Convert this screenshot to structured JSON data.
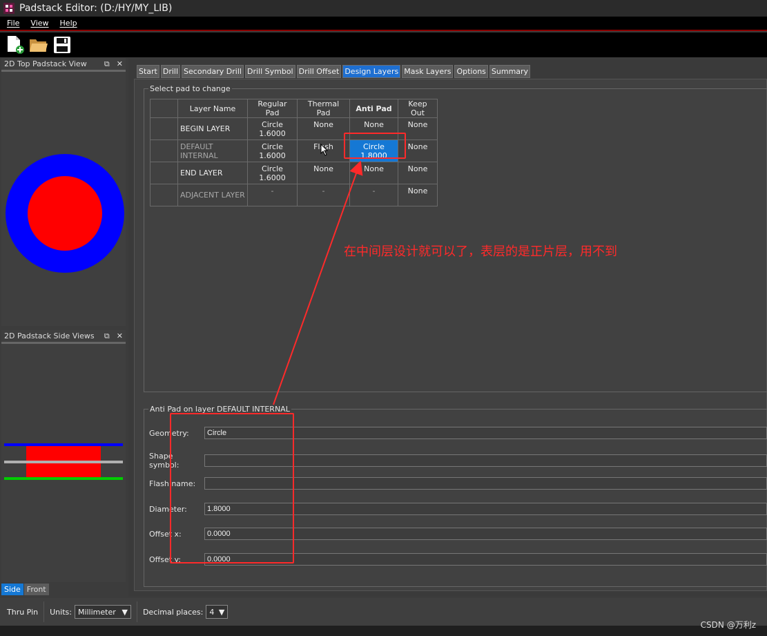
{
  "window": {
    "title": "Padstack Editor:  (D:/HY/MY_LIB)"
  },
  "menu": {
    "file": "File",
    "view": "View",
    "help": "Help"
  },
  "toolbar": {
    "new": "new-icon",
    "open": "folder-open-icon",
    "save": "save-icon"
  },
  "top_view": {
    "title": "2D Top Padstack View",
    "outer_color": "#0000ff",
    "inner_color": "#ff0000"
  },
  "side_view": {
    "title": "2D Padstack Side Views",
    "tabs": [
      "Side",
      "Front"
    ]
  },
  "tabs": [
    "Start",
    "Drill",
    "Secondary Drill",
    "Drill Symbol",
    "Drill Offset",
    "Design Layers",
    "Mask Layers",
    "Options",
    "Summary"
  ],
  "active_tab": "Design Layers",
  "select_group": {
    "title": "Select pad to change"
  },
  "grid": {
    "headers": [
      "Layer Name",
      "Regular Pad",
      "Thermal Pad",
      "Anti Pad",
      "Keep Out"
    ],
    "rows": [
      {
        "layer": "BEGIN LAYER",
        "regular": "Circle 1.6000",
        "thermal": "None",
        "anti": "None",
        "keepout": "None"
      },
      {
        "layer": "DEFAULT INTERNAL",
        "regular": "Circle 1.6000",
        "thermal": "Flash",
        "anti": "Circle 1.8000",
        "keepout": "None"
      },
      {
        "layer": "END LAYER",
        "regular": "Circle 1.6000",
        "thermal": "None",
        "anti": "None",
        "keepout": "None"
      },
      {
        "layer": "ADJACENT LAYER",
        "regular": "-",
        "thermal": "-",
        "anti": "-",
        "keepout": "None"
      }
    ]
  },
  "annotation": {
    "text": "在中间层设计就可以了，表层的是正片层，用不到"
  },
  "detail": {
    "title": "Anti Pad on layer DEFAULT INTERNAL",
    "geometry_label": "Geometry:",
    "geometry": "Circle",
    "shape_label": "Shape symbol:",
    "shape": "",
    "flash_label": "Flash name:",
    "flash": "",
    "diameter_label": "Diameter:",
    "diameter": "1.8000",
    "offsetx_label": "Offset x:",
    "offsetx": "0.0000",
    "offsety_label": "Offset y:",
    "offsety": "0.0000"
  },
  "status": {
    "pin_type": "Thru Pin",
    "units_label": "Units:",
    "units": "Millimeter",
    "decimal_label": "Decimal places:",
    "decimal": "4"
  },
  "watermark": "CSDN @万利z",
  "colors": {
    "accent": "#1578d4",
    "annotation": "#ff2a2a"
  }
}
